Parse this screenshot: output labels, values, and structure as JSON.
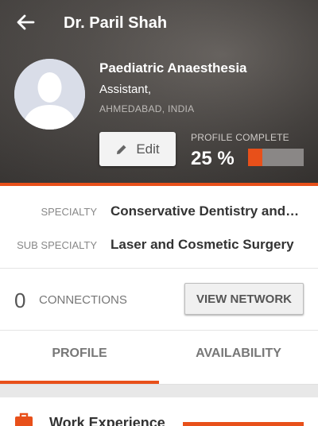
{
  "header": {
    "back_icon": "arrow-left-icon",
    "title": "Dr. Paril Shah"
  },
  "profile": {
    "avatar_icon": "person-silhouette-icon",
    "specialty_title": "Paediatric Anaesthesia",
    "designation": "Assistant,",
    "location": "AHMEDABAD, INDIA",
    "edit_label": "Edit",
    "edit_icon": "pencil-icon",
    "completion_label": "PROFILE COMPLETE",
    "completion_value": "25 %",
    "completion_fraction": 0.25
  },
  "details": {
    "specialty_label": "SPECIALTY",
    "specialty_value": "Conservative Dentistry and…",
    "sub_specialty_label": "SUB SPECIALTY",
    "sub_specialty_value": "Laser and Cosmetic Surgery"
  },
  "connections": {
    "count": "0",
    "label": "CONNECTIONS",
    "view_network_label": "VIEW NETWORK"
  },
  "tabs": [
    {
      "label": "PROFILE",
      "active": true
    },
    {
      "label": "AVAILABILITY",
      "active": false
    }
  ],
  "work": {
    "icon": "briefcase-icon",
    "title": "Work Experience"
  },
  "colors": {
    "accent": "#e8501a",
    "hero_dark": "#3a3735"
  }
}
